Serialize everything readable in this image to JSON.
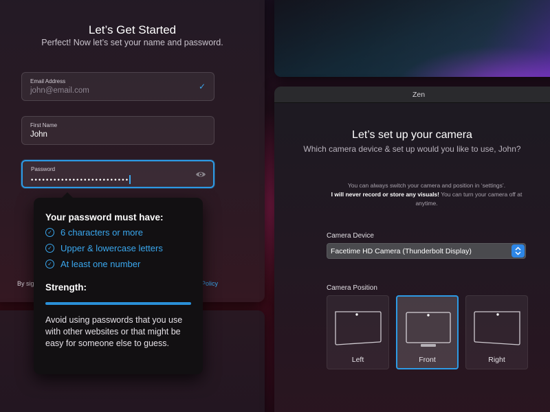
{
  "signup": {
    "title": "Let’s Get Started",
    "subtitle": "Perfect! Now let’s set your name and password.",
    "email": {
      "label": "Email Address",
      "value": "john@email.com"
    },
    "first_name": {
      "label": "First Name",
      "value": "John"
    },
    "password": {
      "label": "Password",
      "masked_value": "••••••••••••••••••••••••••"
    },
    "legal_prefix": "By sig",
    "legal_link": "Policy"
  },
  "password_tooltip": {
    "heading": "Your password must have:",
    "requirements": [
      "6 characters or more",
      "Upper & lowercase letters",
      "At least one number"
    ],
    "strength_label": "Strength:",
    "strength_level": 1.0,
    "advice": "Avoid using passwords that you use with other websites or that might be easy for someone else to guess."
  },
  "camera_window": {
    "window_title": "Zen",
    "title": "Let’s set up your camera",
    "subtitle": "Which camera device & set up would you like to use, John?",
    "note_line1": "You can always switch your camera and position in ‘settings’.",
    "note_bold": "I will never record or store any visuals!",
    "note_rest": " You can turn your camera off at anytime.",
    "device_label": "Camera Device",
    "device_value": "Facetime HD Camera (Thunderbolt Display)",
    "position_label": "Camera Position",
    "positions": [
      "Left",
      "Front",
      "Right"
    ],
    "selected_position": "Front"
  },
  "colors": {
    "accent": "#2d9be6",
    "requirement_text": "#3aa8ef"
  }
}
